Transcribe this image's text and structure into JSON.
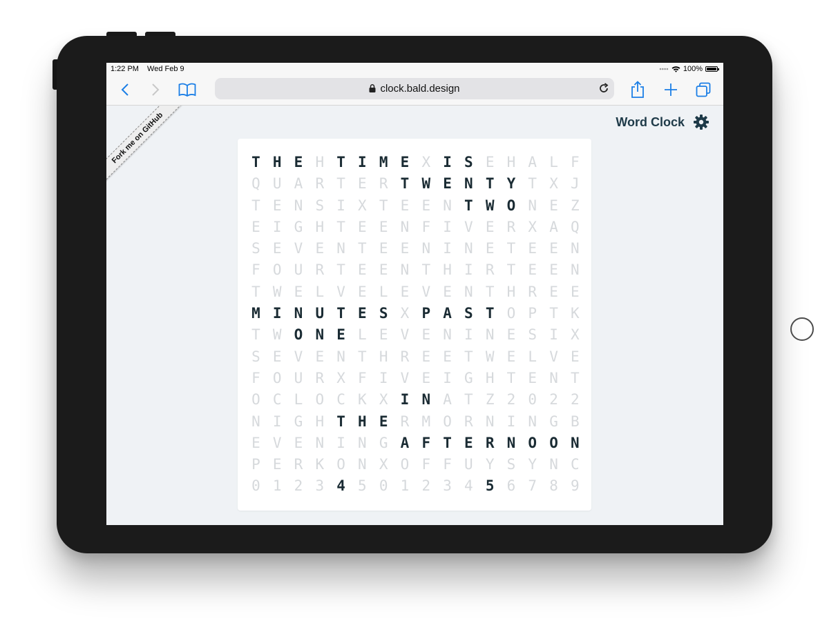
{
  "status_bar": {
    "time": "1:22 PM",
    "date": "Wed Feb 9",
    "battery": "100%",
    "battery_level": 1.0
  },
  "browser": {
    "url": "clock.bald.design",
    "icons": [
      "back-icon",
      "forward-icon",
      "bookmarks-icon",
      "lock-icon",
      "reload-icon",
      "share-icon",
      "new-tab-icon",
      "tabs-icon"
    ]
  },
  "page": {
    "ribbon_text": "Fork me on GitHub",
    "title": "Word Clock",
    "settings_icon": "gear-icon"
  },
  "clock": {
    "rows": [
      "THEHTIMEXISEHALF",
      "QUARTERTWENTYTXJ",
      "TENSIXTEENTWONEZ",
      "EIGHTEENFIVERXAQ",
      "SEVENTEENINETEEN",
      "FOURTEENTHIRTEEN",
      "TWELVELEVENTHREE",
      "MINUTESXPASTOPTK",
      "TWONELEVENINESIX",
      "SEVENTHREETWELVE",
      "FOURXFIVEIGHTENT",
      "OCLOCKXINATZ2022",
      "NIGHTHERMORNINGB",
      "EVENINGAFTERNOON",
      "PERKONXOFFUYSYNC",
      "0123450123456789"
    ],
    "active": [
      [
        0,
        0
      ],
      [
        0,
        1
      ],
      [
        0,
        2
      ],
      [
        0,
        4
      ],
      [
        0,
        5
      ],
      [
        0,
        6
      ],
      [
        0,
        7
      ],
      [
        0,
        9
      ],
      [
        0,
        10
      ],
      [
        1,
        7
      ],
      [
        1,
        8
      ],
      [
        1,
        9
      ],
      [
        1,
        10
      ],
      [
        1,
        11
      ],
      [
        1,
        12
      ],
      [
        2,
        10
      ],
      [
        2,
        11
      ],
      [
        2,
        12
      ],
      [
        7,
        0
      ],
      [
        7,
        1
      ],
      [
        7,
        2
      ],
      [
        7,
        3
      ],
      [
        7,
        4
      ],
      [
        7,
        5
      ],
      [
        7,
        6
      ],
      [
        7,
        8
      ],
      [
        7,
        9
      ],
      [
        7,
        10
      ],
      [
        7,
        11
      ],
      [
        8,
        2
      ],
      [
        8,
        3
      ],
      [
        8,
        4
      ],
      [
        11,
        7
      ],
      [
        11,
        8
      ],
      [
        12,
        4
      ],
      [
        12,
        5
      ],
      [
        12,
        6
      ],
      [
        13,
        7
      ],
      [
        13,
        8
      ],
      [
        13,
        9
      ],
      [
        13,
        10
      ],
      [
        13,
        11
      ],
      [
        13,
        12
      ],
      [
        13,
        13
      ],
      [
        13,
        14
      ],
      [
        13,
        15
      ],
      [
        15,
        4
      ],
      [
        15,
        11
      ]
    ],
    "active_color": "#1a2b33",
    "inactive_color": "#d6d9dc"
  }
}
